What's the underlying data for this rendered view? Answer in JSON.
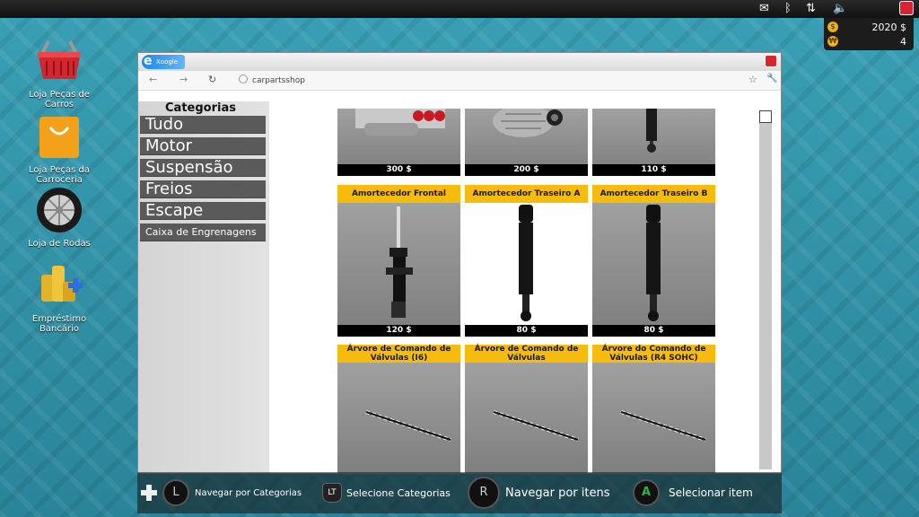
{
  "status": {
    "money": "2020 $",
    "tokens": "4",
    "coin_symbol": "$",
    "token_symbol": "₩"
  },
  "desktop": [
    {
      "name": "basket",
      "label": "Loja Peças de Carros"
    },
    {
      "name": "bag",
      "label": "Loja Peças da Carroceria"
    },
    {
      "name": "wheel",
      "label": "Loja de Rodas"
    },
    {
      "name": "coins",
      "label": "Empréstimo Bancário"
    }
  ],
  "browser": {
    "url": "carpartsshop",
    "tab_logo_text": "Xoogle"
  },
  "sidebar": {
    "title": "Categorias",
    "items": [
      "Tudo",
      "Motor",
      "Suspensão",
      "Freios",
      "Escape",
      "Caixa de Engrenagens"
    ]
  },
  "products": [
    {
      "title": "",
      "price": "300 $",
      "icon": "intake-manifold-icon"
    },
    {
      "title": "",
      "price": "200 $",
      "icon": "alternator-icon"
    },
    {
      "title": "",
      "price": "110 $",
      "icon": "shock-absorber-icon"
    },
    {
      "title": "Amortecedor Frontal",
      "price": "120 $",
      "icon": "strut-icon"
    },
    {
      "title": "Amortecedor Traseiro A",
      "price": "80 $",
      "icon": "shock-absorber-icon"
    },
    {
      "title": "Amortecedor Traseiro B",
      "price": "80 $",
      "icon": "shock-absorber-icon"
    },
    {
      "title": "Árvore de Comando de Válvulas (I6)",
      "price": "",
      "icon": "camshaft-icon"
    },
    {
      "title": "Árvore de Comando de Válvulas",
      "price": "",
      "icon": "camshaft-icon"
    },
    {
      "title": "Árvore do Comando de Válvulas (R4 SOHC)",
      "price": "",
      "icon": "camshaft-icon"
    }
  ],
  "hints": {
    "nav_categories": "Navegar por Categorias",
    "select_categories": "Selecione Categorias",
    "nav_items": "Navegar por itens",
    "select_item": "Selecionar item",
    "btn_l": "L",
    "btn_lt": "LT",
    "btn_r": "R",
    "btn_a": "A"
  },
  "colors": {
    "accent": "#f7bb0e",
    "category_bg": "#5a5a5a",
    "close_red": "#d8242f"
  }
}
